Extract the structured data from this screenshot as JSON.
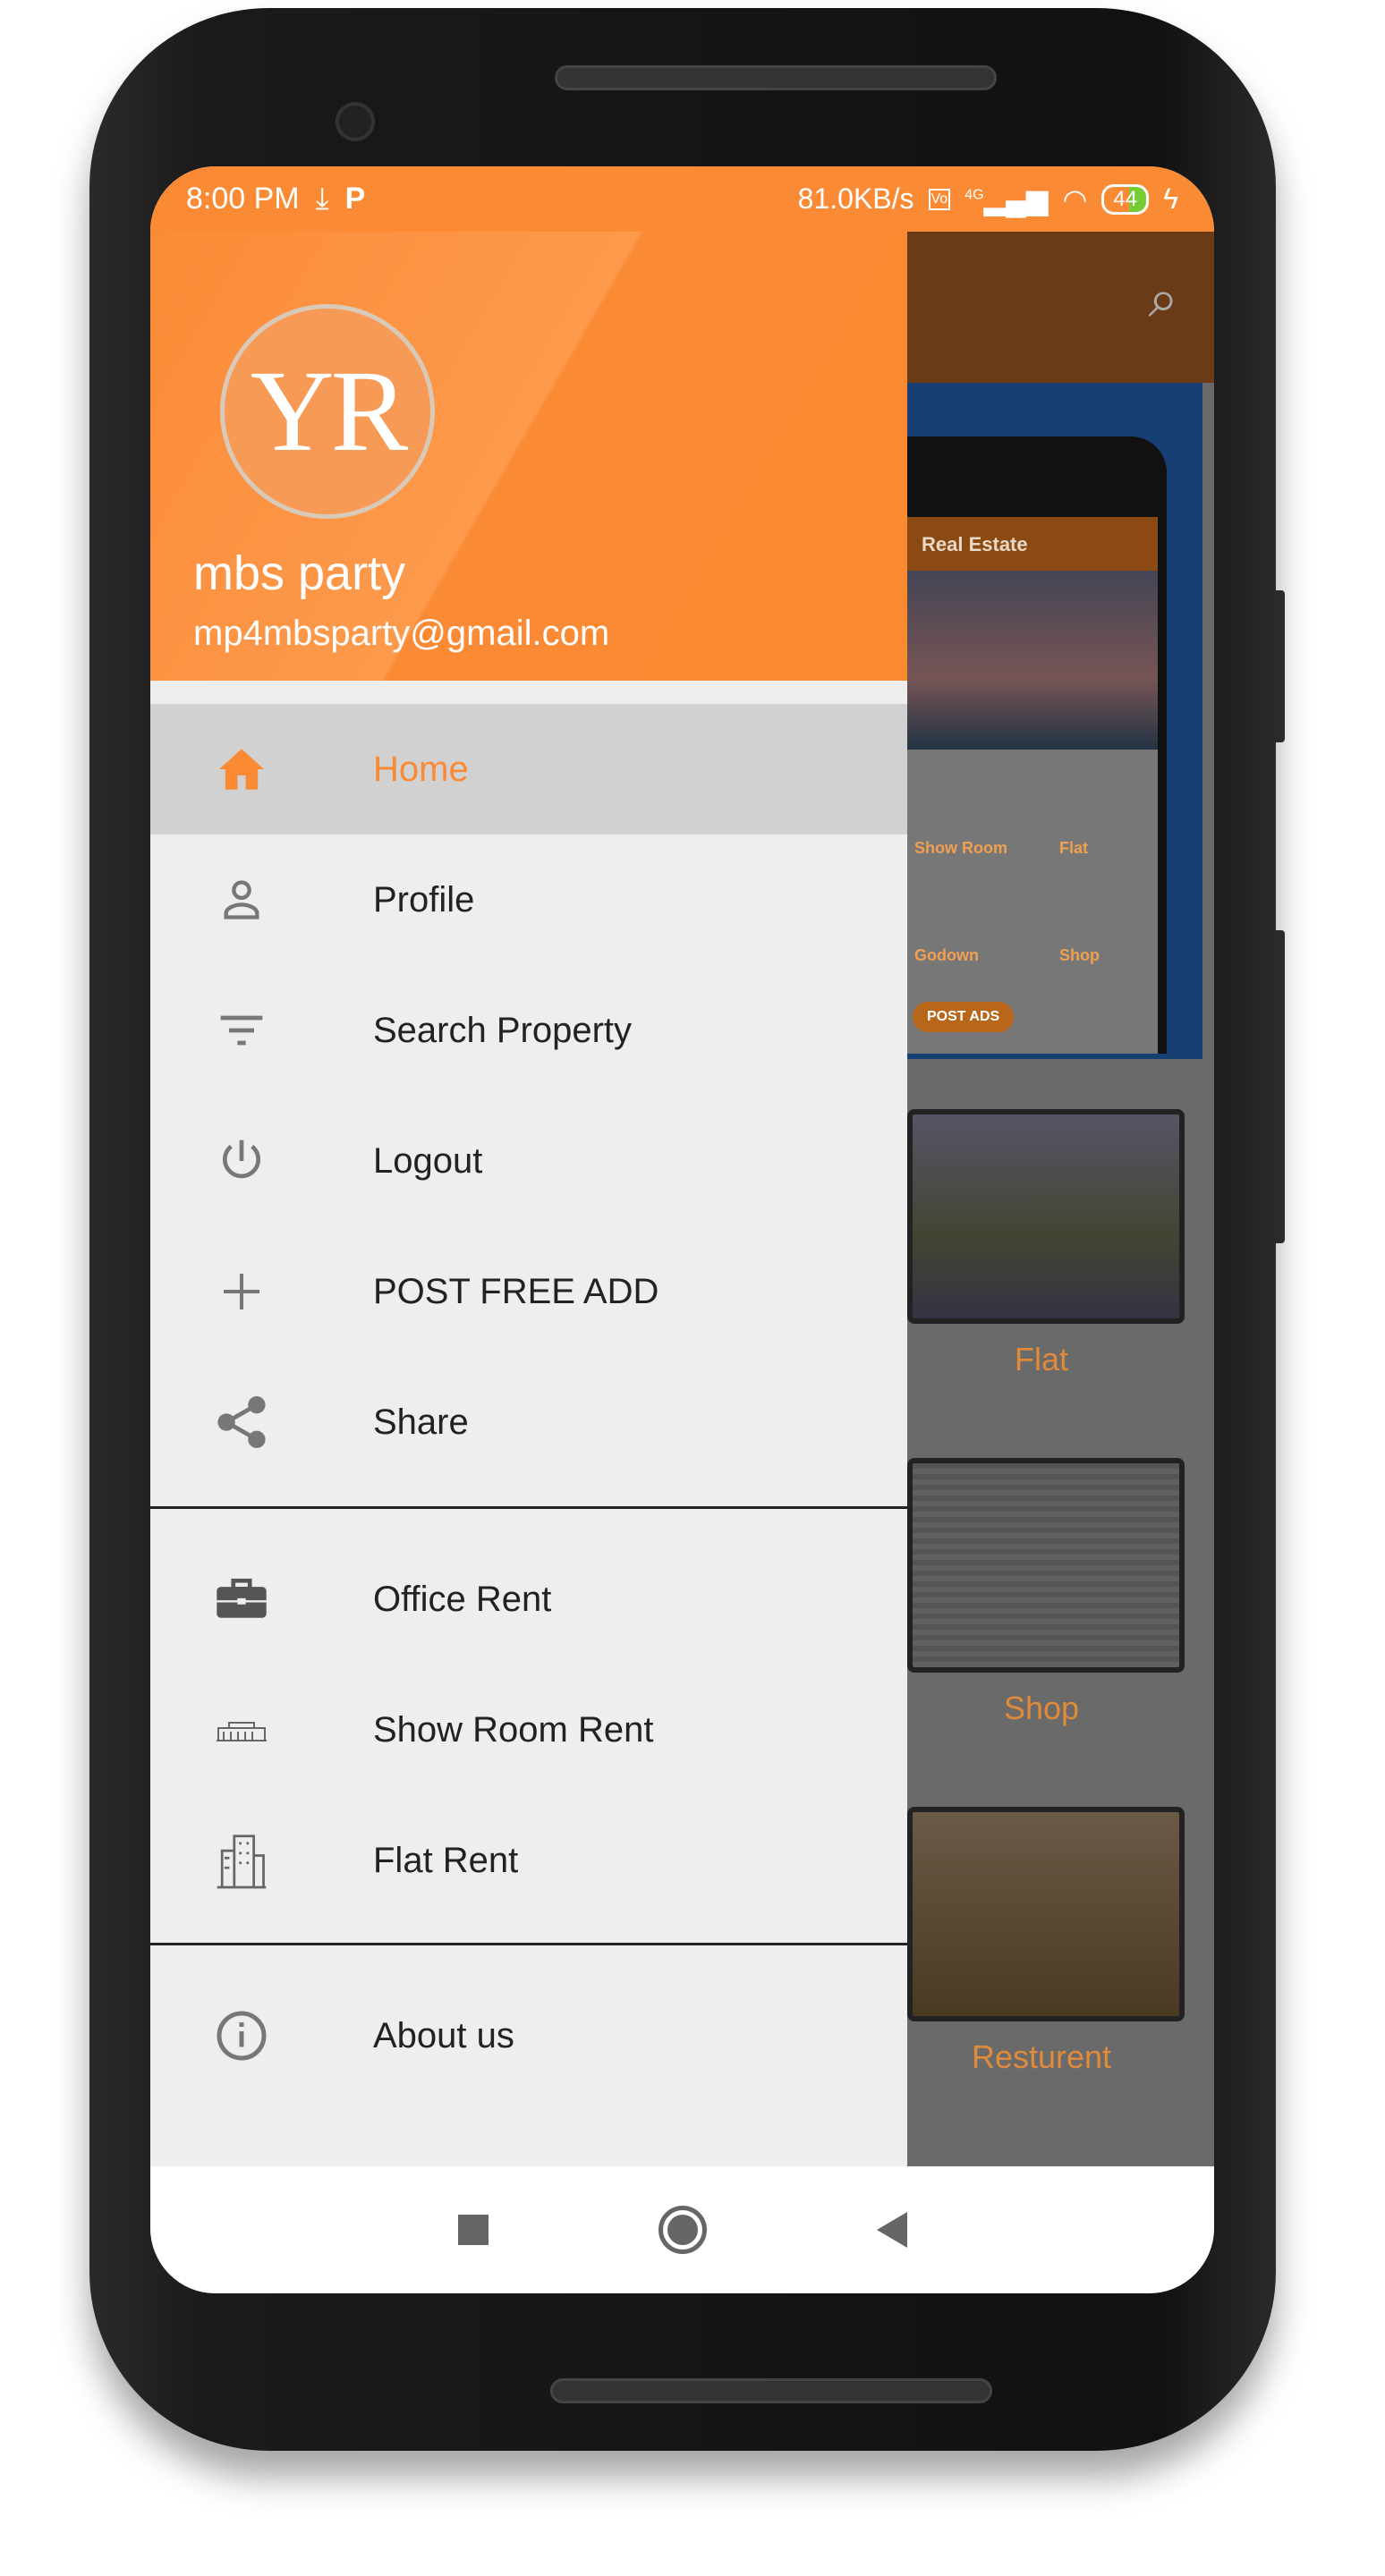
{
  "status_bar": {
    "time": "8:00 PM",
    "speed": "81.0KB/s",
    "network": "4G",
    "battery": "44"
  },
  "background": {
    "mini_title": "Real Estate",
    "mini_items": [
      "Show Room",
      "Flat",
      "Godown",
      "Shop"
    ],
    "mini_post": "POST ADS",
    "cards": [
      "Flat",
      "Shop",
      "Resturent"
    ]
  },
  "drawer": {
    "avatar_initials": "YR",
    "user_name": "mbs party",
    "user_email": "mp4mbsparty@gmail.com",
    "items": [
      {
        "label": "Home",
        "icon": "home-icon",
        "selected": true
      },
      {
        "label": "Profile",
        "icon": "person-icon"
      },
      {
        "label": "Search Property",
        "icon": "filter-icon"
      },
      {
        "label": "Logout",
        "icon": "power-icon"
      },
      {
        "label": "POST FREE ADD",
        "icon": "plus-icon"
      },
      {
        "label": "Share",
        "icon": "share-icon"
      },
      {
        "label": "Office Rent",
        "icon": "briefcase-icon"
      },
      {
        "label": "Show Room Rent",
        "icon": "showroom-icon"
      },
      {
        "label": "Flat Rent",
        "icon": "building-icon"
      },
      {
        "label": "About us",
        "icon": "info-icon"
      }
    ]
  },
  "colors": {
    "accent": "#fb8a35",
    "selected_bg": "#d1d1d1",
    "drawer_bg": "#eeeeee"
  }
}
